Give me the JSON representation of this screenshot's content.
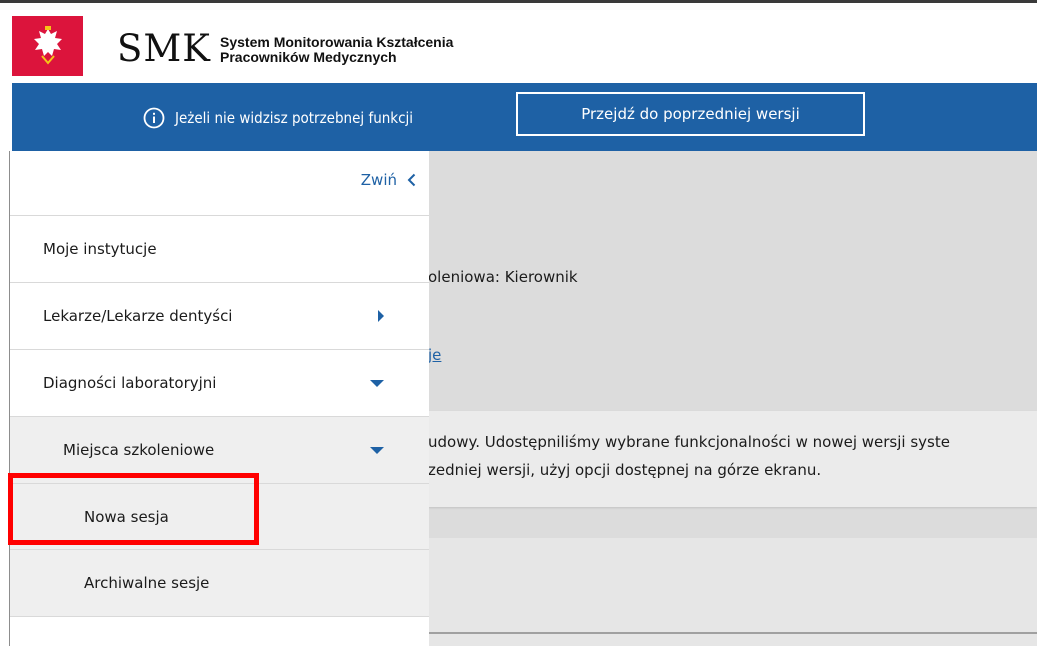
{
  "header": {
    "logo_text": "SMK",
    "subtitle_line1": "System Monitorowania Kształcenia",
    "subtitle_line2": "Pracowników Medycznych"
  },
  "banner": {
    "message": "Jeżeli nie widzisz potrzebnej funkcji",
    "button_label": "Przejdź do poprzedniej wersji",
    "icon": "info-icon"
  },
  "sidebar": {
    "collapse_label": "Zwiń",
    "items": [
      {
        "label": "Moje instytucje"
      },
      {
        "label": "Lekarze/Lekarze dentyści"
      },
      {
        "label": "Diagności laboratoryjni"
      },
      {
        "label": "Miejsca szkoleniowe"
      },
      {
        "label": "Nowa sesja"
      },
      {
        "label": "Archiwalne sesje"
      }
    ]
  },
  "content": {
    "role_text": "oleniowa: Kierownik",
    "link_text": "je",
    "notice_line1": "udowy. Udostępniliśmy wybrane funkcjonalności w nowej wersji syste",
    "notice_line2": "zedniej wersji, użyj opcji dostępnej na górze ekranu."
  },
  "colors": {
    "primary": "#1e61a5",
    "emblem_red": "#dc143c",
    "highlight": "#ff0000"
  }
}
